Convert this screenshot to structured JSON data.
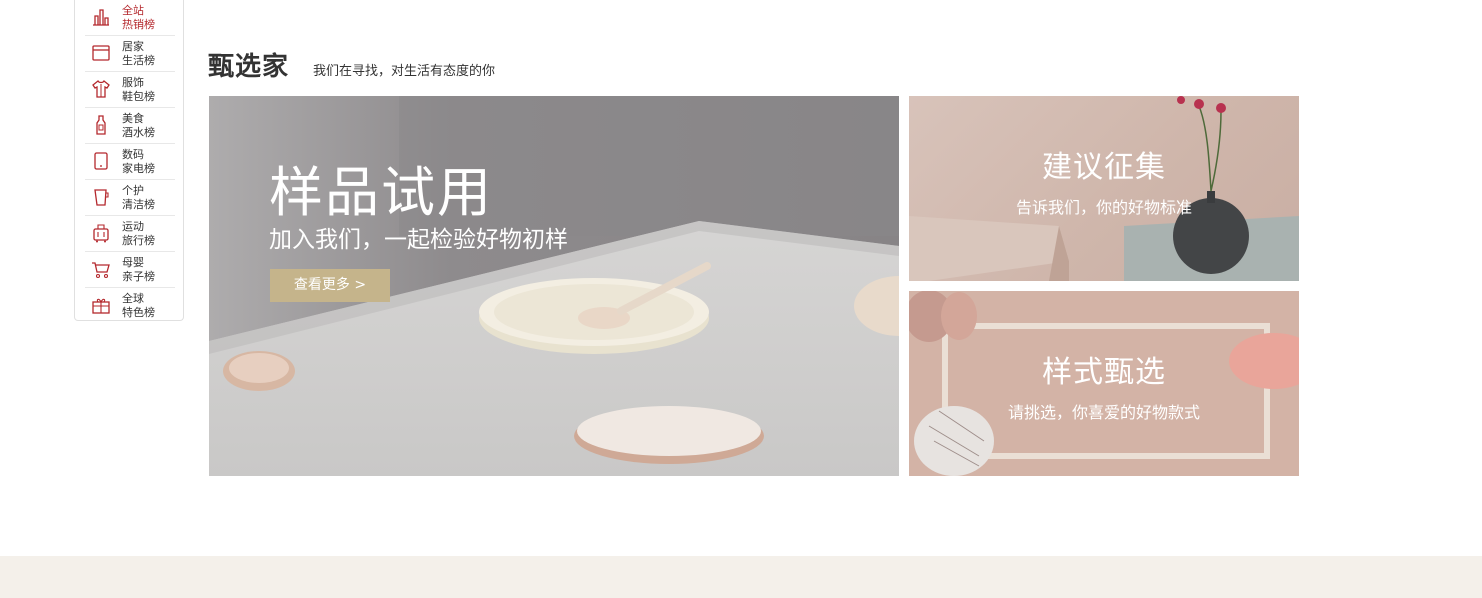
{
  "rank_nav": {
    "items": [
      {
        "line1": "全站",
        "line2": "热销榜",
        "icon": "bar-chart-icon",
        "active": true
      },
      {
        "line1": "居家",
        "line2": "生活榜",
        "icon": "home-appliance-icon",
        "active": false
      },
      {
        "line1": "服饰",
        "line2": "鞋包榜",
        "icon": "clothing-icon",
        "active": false
      },
      {
        "line1": "美食",
        "line2": "酒水榜",
        "icon": "bottle-icon",
        "active": false
      },
      {
        "line1": "数码",
        "line2": "家电榜",
        "icon": "phone-icon",
        "active": false
      },
      {
        "line1": "个护",
        "line2": "清洁榜",
        "icon": "cup-icon",
        "active": false
      },
      {
        "line1": "运动",
        "line2": "旅行榜",
        "icon": "luggage-icon",
        "active": false
      },
      {
        "line1": "母婴",
        "line2": "亲子榜",
        "icon": "stroller-icon",
        "active": false
      },
      {
        "line1": "全球",
        "line2": "特色榜",
        "icon": "gift-icon",
        "active": false
      }
    ],
    "accent_color": "#b4282d"
  },
  "section": {
    "title": "甄选家",
    "subtitle": "我们在寻找，对生活有态度的你"
  },
  "main_banner": {
    "title": "样品试用",
    "subtitle": "加入我们，一起检验好物初样",
    "button": "查看更多 >",
    "button_color": "#c5b48b"
  },
  "side_banners": [
    {
      "title": "建议征集",
      "subtitle": "告诉我们，你的好物标准"
    },
    {
      "title": "样式甄选",
      "subtitle": "请挑选，你喜爱的好物款式"
    }
  ]
}
